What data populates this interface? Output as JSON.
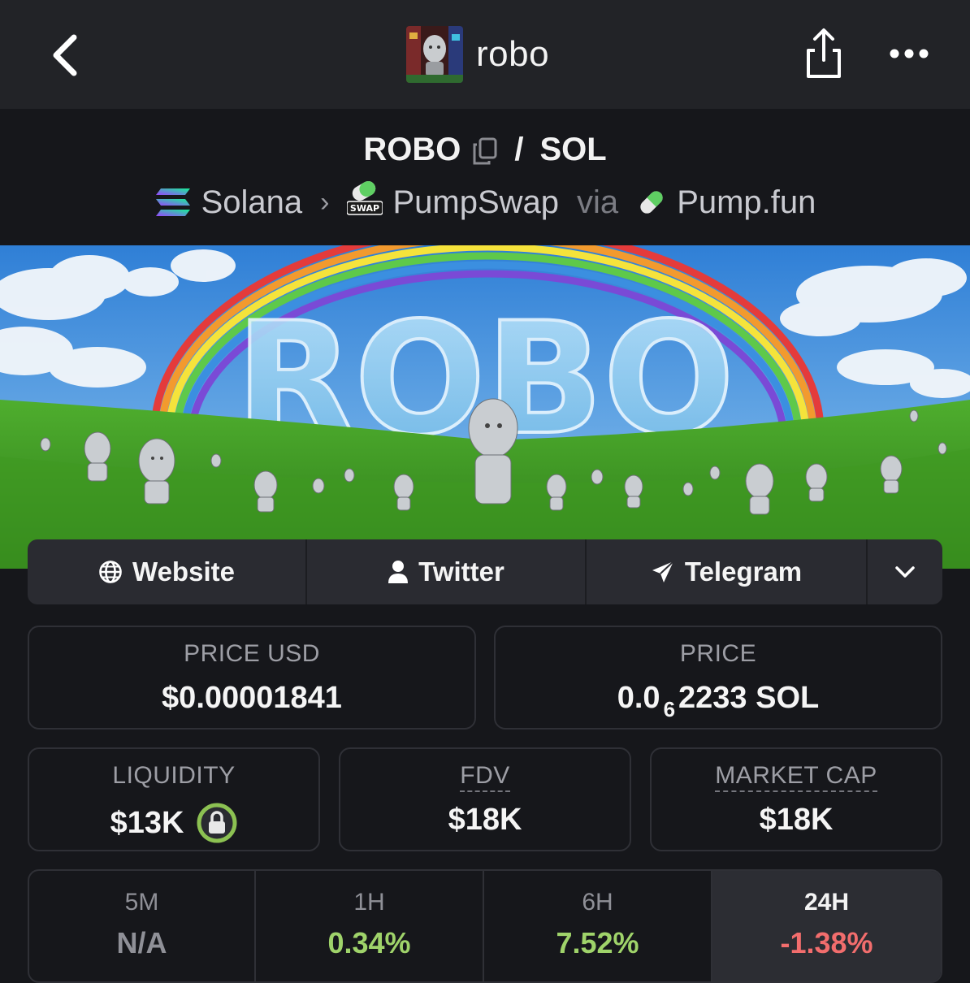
{
  "topbar": {
    "title": "robo"
  },
  "pair": {
    "base": "ROBO",
    "separator": "/",
    "quote": "SOL"
  },
  "route": {
    "chain": "Solana",
    "dex": "PumpSwap",
    "via": "via",
    "launchpad": "Pump.fun",
    "swap_badge": "SWAP"
  },
  "banner": {
    "wordmark": "ROBO"
  },
  "links": {
    "website": "Website",
    "twitter": "Twitter",
    "telegram": "Telegram"
  },
  "stats": {
    "price_usd_label": "PRICE USD",
    "price_usd_value": "$0.00001841",
    "price_label": "PRICE",
    "price_prefix": "0.0",
    "price_zeros": "6",
    "price_suffix": "2233 SOL",
    "liquidity_label": "LIQUIDITY",
    "liquidity_value": "$13K",
    "fdv_label": "FDV",
    "fdv_value": "$18K",
    "mcap_label": "MARKET CAP",
    "mcap_value": "$18K"
  },
  "timeframes": [
    {
      "label": "5M",
      "value": "N/A",
      "color": "#8f9097"
    },
    {
      "label": "1H",
      "value": "0.34%",
      "color": "#9fd36a"
    },
    {
      "label": "6H",
      "value": "7.52%",
      "color": "#9fd36a"
    },
    {
      "label": "24H",
      "value": "-1.38%",
      "color": "#f26d6d"
    }
  ],
  "colors": {
    "topbar": "#222327",
    "background": "#16171b",
    "positive": "#9fd36a",
    "negative": "#f26d6d",
    "lock_ring": "#8cc152"
  }
}
